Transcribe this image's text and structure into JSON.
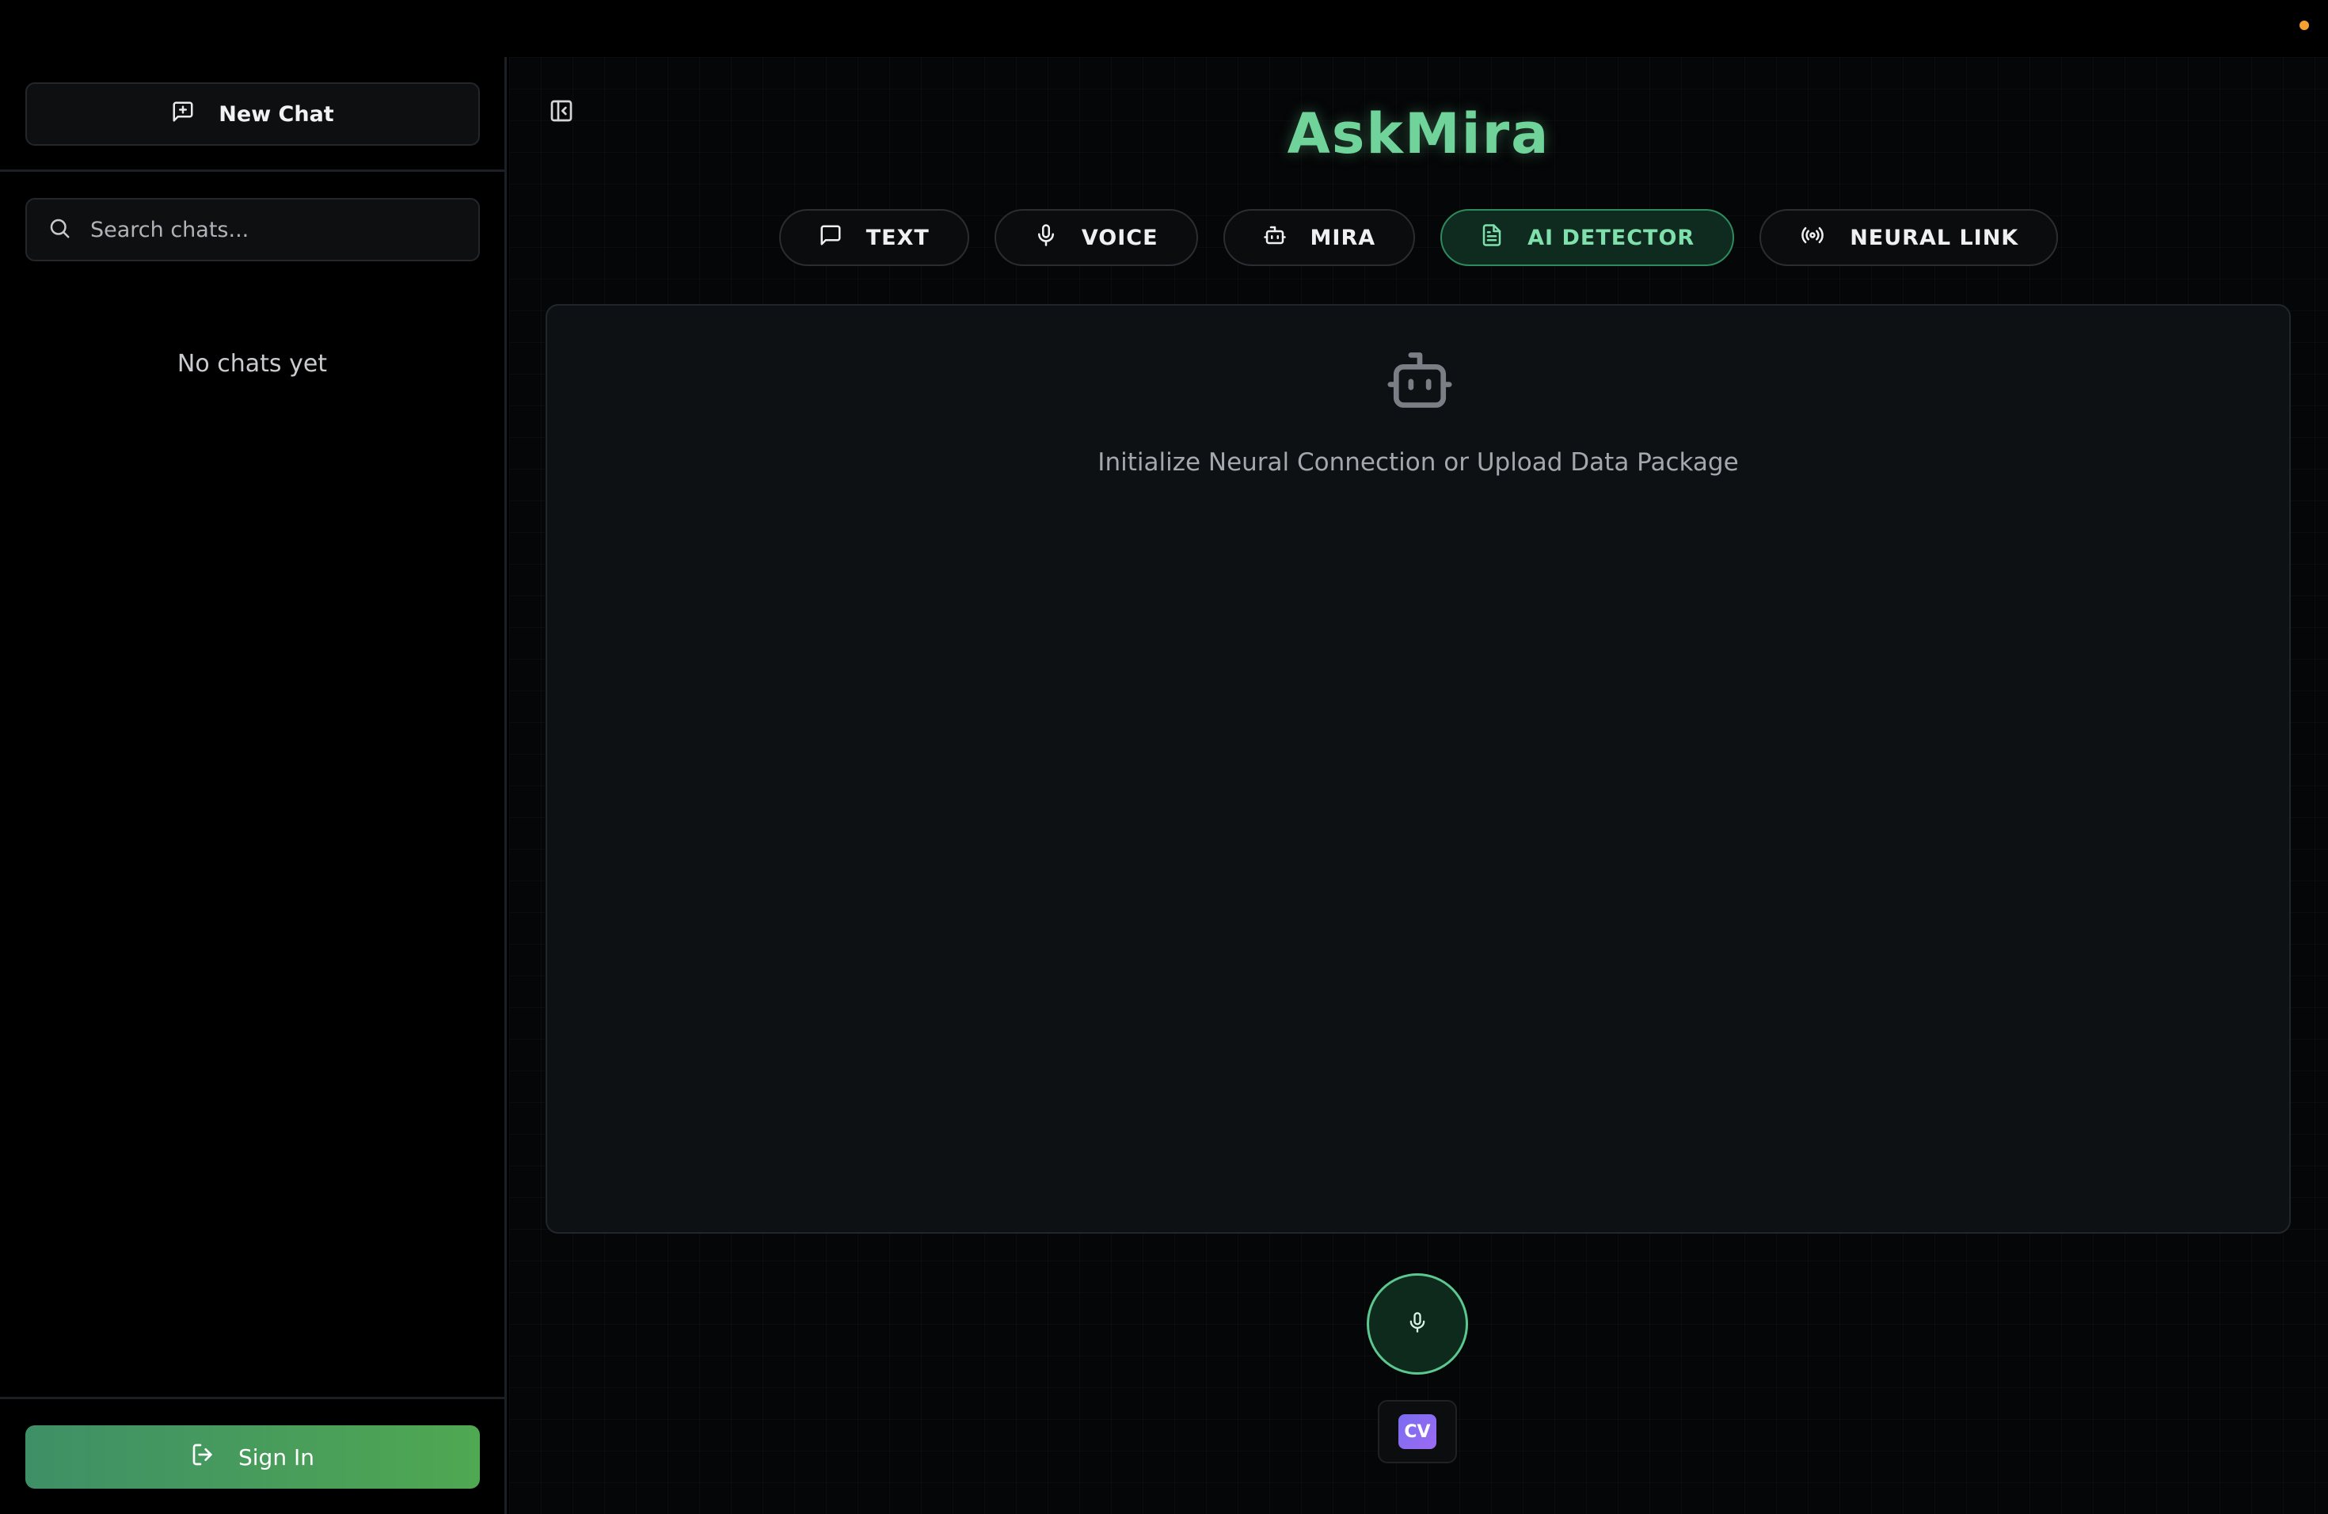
{
  "sidebar": {
    "new_chat_label": "New Chat",
    "search_placeholder": "Search chats...",
    "empty_label": "No chats yet",
    "sign_in_label": "Sign In"
  },
  "header": {
    "title": "AskMira"
  },
  "mode_tabs": [
    {
      "label": "TEXT",
      "icon": "message-square-icon",
      "active": false
    },
    {
      "label": "VOICE",
      "icon": "microphone-icon",
      "active": false
    },
    {
      "label": "MIRA",
      "icon": "bot-icon",
      "active": false
    },
    {
      "label": "AI DETECTOR",
      "icon": "file-text-icon",
      "active": true
    },
    {
      "label": "NEURAL LINK",
      "icon": "radio-waves-icon",
      "active": false
    }
  ],
  "main": {
    "placeholder": "Initialize Neural Connection or Upload Data Package",
    "cv_badge": "CV"
  },
  "colors": {
    "accent": "#6fd39a",
    "sign_in_gradient_start": "#3f8f66",
    "sign_in_gradient_end": "#4fa852",
    "status_dot": "#f5a030",
    "cv_badge": "#8a6cf1"
  }
}
